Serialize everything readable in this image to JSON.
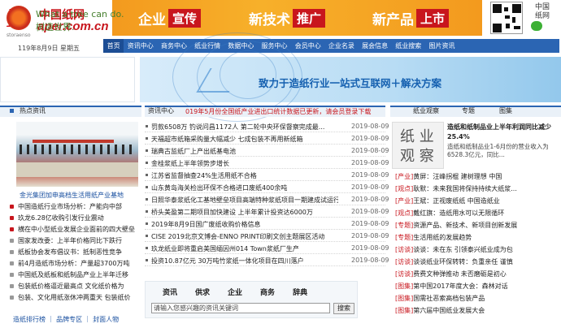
{
  "header": {
    "logo_cn": "中国纸网",
    "logo_p": "P",
    "logo_en": "aper.com.cn",
    "slogans": [
      {
        "word": "企业",
        "badge": "宣传"
      },
      {
        "word": "新技术",
        "badge": "推广"
      },
      {
        "word": "新产品",
        "badge": "上市"
      }
    ],
    "side_logo": "中国\n纸网"
  },
  "date": "119年8月9日 星期五",
  "nav": [
    "首页",
    "资讯中心",
    "商务中心",
    "纸业行情",
    "数据中心",
    "服务中心",
    "会员中心",
    "企业名录",
    "展会信息",
    "纸业搜索",
    "图片资讯"
  ],
  "ad_left": {
    "line1": "What a tree can do.",
    "line2": "树造世界.",
    "brand": "storaenso"
  },
  "ad_right": {
    "text": "致力于造纸行业一站式互联网＋解决方案"
  },
  "hot": {
    "title": "热点资讯",
    "caption": "金光集团加申高档生活用纸产业基地",
    "items": [
      "中国造纸行业市场分析：产能向中部",
      "玖龙6.28亿收购引发行业震动",
      "横在中小型纸业发展企业面前的四大壁垒",
      "国家发改委：上半年价格同比下跌行",
      "纸板协会发布倡议书：抵制恶性竞争",
      "前4月造纸市场分析：产量超3700万吨",
      "中国纸及纸板和纸制品产业上半年迁移",
      "包装纸价格逼近最高点 文化纸价格为",
      "包装、文化用纸涨休冲两重天 包装纸价"
    ],
    "bottom": "造纸排行榜 ｜ 品牌专区 ｜ 封面人物"
  },
  "middle": {
    "tab": "资讯中心",
    "notice": "019年5月份全国纸产业进出口统计数据已更新，请会员登录下载",
    "news": [
      {
        "title": "罚款6508万 钓说问昌1172人 第二轮中央环保督察完成最...",
        "date": "2019-08-09"
      },
      {
        "title": "天福超市纸箱采购量大幅减少 七成包装不再用新纸箱",
        "date": "2019-08-09"
      },
      {
        "title": "瑞典古监纸厂上产出纸基电池",
        "date": "2019-08-09"
      },
      {
        "title": "金桂浆纸上半年领势步增长",
        "date": "2019-08-09"
      },
      {
        "title": "江苏省监督抽查24%生活用纸不合格",
        "date": "2019-08-09"
      },
      {
        "title": "山东黄岛海关检出环保不合格进口废纸400余吨",
        "date": "2019-08-09"
      },
      {
        "title": "日照华泰浆纸化工基地壁垒项目高端特种浆纸项目一期建成试运行",
        "date": "2019-08-09"
      },
      {
        "title": "桥头美盈第二期项目加快建设 上半年累计投资达6000万",
        "date": "2019-08-09"
      },
      {
        "title": "2019年8月9日国广废纸收购价格信息",
        "date": "2019-08-09"
      },
      {
        "title": "CISE 2019北京文博会-ENNO PRINT印刷文创主题展区活动",
        "date": "2019-08-09"
      },
      {
        "title": "玖龙纸业即将重启美国缅因州014 Town浆纸厂生产",
        "date": "2019-08-09"
      },
      {
        "title": "投资10.87亿元 30万吨竹浆纸一体化项目在四川落户",
        "date": "2019-08-09"
      }
    ],
    "search_tabs": [
      "资讯",
      "供求",
      "企业",
      "商务",
      "辞典"
    ],
    "search_placeholder": "请输入您感兴趣的资讯关键词",
    "search_button": "搜索"
  },
  "right": {
    "tabs": [
      "纸业观察",
      "专题",
      "图集"
    ],
    "obs_a": "纸 业",
    "obs_b": "观 察",
    "obs_title": "造纸和纸制品业上半年利润同比减少25.4%",
    "obs_body": "造纸和纸制品业1-6月份的营业收入为6528.3亿元，同比...",
    "items": [
      {
        "tag": "[产业]",
        "text": "黄屏：汪峰拐棍 建树理想 中国"
      },
      {
        "tag": "[观点]",
        "text": "耿默：未来我国将保持持续大纸浆..."
      },
      {
        "tag": "[产业]",
        "text": "王斌：正视废纸纸 中国造纸业"
      },
      {
        "tag": "[观点]",
        "text": "戴红旗：造纸用水可以无限循环"
      },
      {
        "tag": "[专题]",
        "text": "资源产品、新技术、新项目创新发展"
      },
      {
        "tag": "[专题]",
        "text": "生活用纸的发展趋势"
      },
      {
        "tag": "[访谈]",
        "text": "谈谈：未在东 引领泰兴纸业成为包"
      },
      {
        "tag": "[访谈]",
        "text": "谈谈纸业环保转转：负重亲任 谨慎"
      },
      {
        "tag": "[访谈]",
        "text": "费费文种弹推动 未否磨砺是初心"
      },
      {
        "tag": "[图集]",
        "text": "第中国2017年度大会：森林对话"
      },
      {
        "tag": "[图集]",
        "text": "国需社恶索高档包装产品"
      },
      {
        "tag": "[图集]",
        "text": "第六届中国纸业发展大会"
      }
    ]
  }
}
